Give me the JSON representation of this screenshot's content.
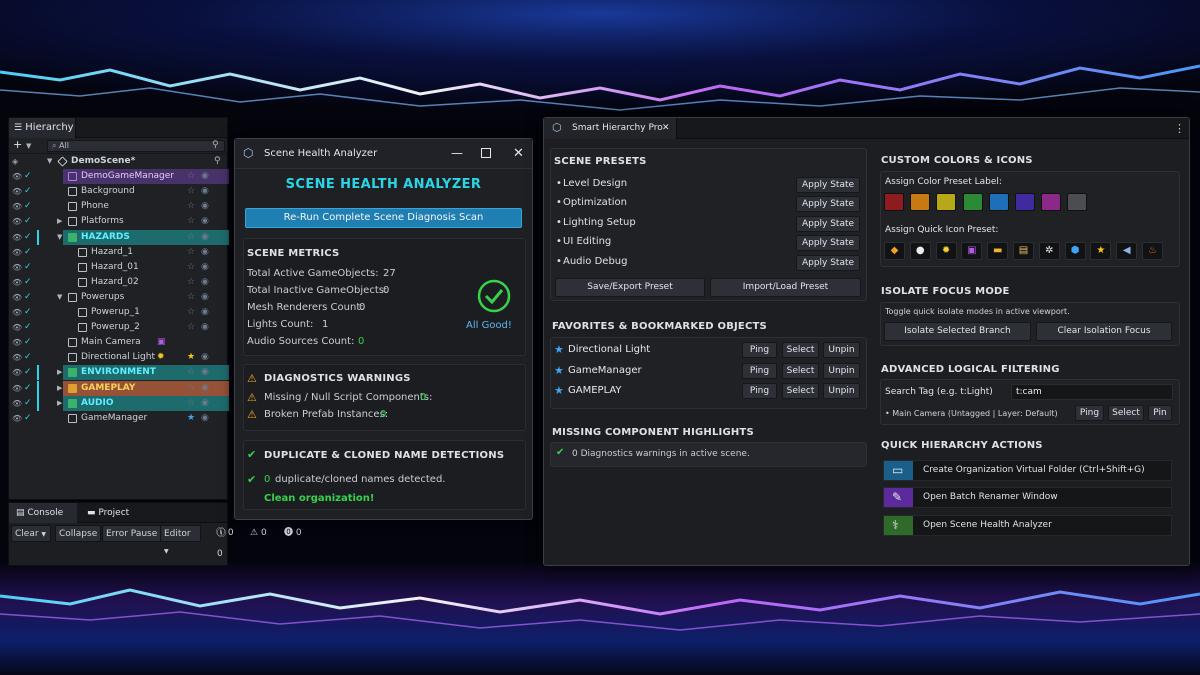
{
  "colors": {
    "accent_cyan": "#29d5e6",
    "success_green": "#35d24a",
    "warning_orange": "#f5a623",
    "star_blue": "#3fa4f5"
  },
  "hierarchy": {
    "tab_label": "Hierarchy",
    "toolbar_add": "+",
    "search_placeholder": "All",
    "rows": [
      {
        "label": "DemoScene*",
        "highlight": "none",
        "icon": "unity-logo-icon"
      },
      {
        "label": "DemoGameManager",
        "highlight": "purple",
        "icon": "cube-icon"
      },
      {
        "label": "Background",
        "highlight": "none",
        "icon": "cube-icon"
      },
      {
        "label": "Phone",
        "highlight": "none",
        "icon": "cube-icon"
      },
      {
        "label": "Platforms",
        "highlight": "none",
        "icon": "cube-icon"
      },
      {
        "label": "HAZARDS",
        "highlight": "teal",
        "icon": "folder-icon"
      },
      {
        "label": "Hazard_1",
        "highlight": "none",
        "icon": "cube-icon"
      },
      {
        "label": "Hazard_01",
        "highlight": "none",
        "icon": "cube-icon"
      },
      {
        "label": "Hazard_02",
        "highlight": "none",
        "icon": "cube-icon"
      },
      {
        "label": "Powerups",
        "highlight": "none",
        "icon": "cube-icon"
      },
      {
        "label": "Powerup_1",
        "highlight": "none",
        "icon": "cube-icon"
      },
      {
        "label": "Powerup_2",
        "highlight": "none",
        "icon": "cube-icon"
      },
      {
        "label": "Main Camera",
        "highlight": "none",
        "icon": "camera-icon"
      },
      {
        "label": "Directional Light",
        "highlight": "none",
        "icon": "cube-icon"
      },
      {
        "label": "ENVIRONMENT",
        "highlight": "teal",
        "icon": "folder-icon"
      },
      {
        "label": "GAMEPLAY",
        "highlight": "orange",
        "icon": "folder-icon"
      },
      {
        "label": "AUDIO",
        "highlight": "teal",
        "icon": "folder-icon"
      },
      {
        "label": "GameManager",
        "highlight": "none",
        "icon": "cube-icon"
      }
    ]
  },
  "console": {
    "tab_console": "Console",
    "tab_project": "Project",
    "clear": "Clear",
    "collapse": "Collapse",
    "error_pause": "Error Pause",
    "editor": "Editor",
    "info_count": "0",
    "warn_count": "0",
    "error_count": "0"
  },
  "health": {
    "window_title": "Scene Health Analyzer",
    "heading": "SCENE HEALTH ANALYZER",
    "rerun_button": "Re-Run Complete Scene Diagnosis Scan",
    "metrics_title": "SCENE METRICS",
    "metrics": [
      {
        "label": "Total Active GameObjects:",
        "value": "27"
      },
      {
        "label": "Total Inactive GameObjects:",
        "value": "0"
      },
      {
        "label": "Mesh Renderers Count:",
        "value": "0"
      },
      {
        "label": "Lights Count:",
        "value": "1"
      },
      {
        "label": "Audio Sources Count:",
        "value": "0"
      }
    ],
    "all_good": "All Good!",
    "warnings_title": "DIAGNOSTICS WARNINGS",
    "warnings": [
      {
        "label": "Missing / Null Script Components:",
        "value": "0"
      },
      {
        "label": "Broken Prefab Instances:",
        "value": "0"
      }
    ],
    "dup_title": "DUPLICATE & CLONED NAME DETECTIONS",
    "dup_count": "0",
    "dup_text": "duplicate/cloned names detected.",
    "clean": "Clean organization!"
  },
  "smart": {
    "tab_label": "Smart Hierarchy Pro",
    "presets_title": "SCENE PRESETS",
    "presets": [
      {
        "label": "Level Design",
        "button": "Apply State"
      },
      {
        "label": "Optimization",
        "button": "Apply State"
      },
      {
        "label": "Lighting Setup",
        "button": "Apply State"
      },
      {
        "label": "UI Editing",
        "button": "Apply State"
      },
      {
        "label": "Audio Debug",
        "button": "Apply State"
      }
    ],
    "save_preset": "Save/Export Preset",
    "load_preset": "Import/Load Preset",
    "favorites_title": "FAVORITES & BOOKMARKED OBJECTS",
    "favorites": [
      {
        "label": "Directional Light",
        "ping": "Ping",
        "select": "Select",
        "unpin": "Unpin"
      },
      {
        "label": "GameManager",
        "ping": "Ping",
        "select": "Select",
        "unpin": "Unpin"
      },
      {
        "label": "GAMEPLAY",
        "ping": "Ping",
        "select": "Select",
        "unpin": "Unpin"
      }
    ],
    "missing_title": "MISSING COMPONENT HIGHLIGHTS",
    "missing_text": "0 Diagnostics warnings in active scene.",
    "colors_title": "CUSTOM COLORS & ICONS",
    "color_label": "Assign Color Preset Label:",
    "swatches": [
      "#8e1b1d",
      "#c77a12",
      "#b6a819",
      "#2b8a36",
      "#1f6fb8",
      "#3f2aa0",
      "#8a2a86",
      "#4b4d52"
    ],
    "icon_label": "Assign Quick Icon Preset:",
    "icons": [
      {
        "name": "cube-icon",
        "glyph": "◆",
        "color": "#f0a02b"
      },
      {
        "name": "sphere-icon",
        "glyph": "●",
        "color": "#e8ecf0"
      },
      {
        "name": "lightbulb-icon",
        "glyph": "✹",
        "color": "#f5d23a"
      },
      {
        "name": "camera-icon",
        "glyph": "▣",
        "color": "#b05ae8"
      },
      {
        "name": "folder-icon",
        "glyph": "▬",
        "color": "#f0b430"
      },
      {
        "name": "script-icon",
        "glyph": "▤",
        "color": "#e3c06a"
      },
      {
        "name": "gear-icon",
        "glyph": "✲",
        "color": "#e8ecf0"
      },
      {
        "name": "prefab-icon",
        "glyph": "⬢",
        "color": "#3fa4f5"
      },
      {
        "name": "star-icon",
        "glyph": "★",
        "color": "#f5c61e"
      },
      {
        "name": "audio-icon",
        "glyph": "◀",
        "color": "#8fb4e8"
      },
      {
        "name": "fire-icon",
        "glyph": "♨",
        "color": "#f56a1e"
      }
    ],
    "isolate_title": "ISOLATE FOCUS MODE",
    "isolate_desc": "Toggle quick isolate modes in active viewport.",
    "isolate_branch": "Isolate Selected Branch",
    "clear_isolation": "Clear Isolation Focus",
    "filter_title": "ADVANCED LOGICAL FILTERING",
    "search_tag_label": "Search Tag (e.g. t:Light)",
    "search_tag_value": "t:cam",
    "result_text": "• Main Camera (Untagged | Layer: Default)",
    "result_ping": "Ping",
    "result_select": "Select",
    "result_pin": "Pin",
    "actions_title": "QUICK HIERARCHY ACTIONS",
    "actions": [
      {
        "label": "Create Organization Virtual Folder (Ctrl+Shift+G)",
        "icon": "folder-icon",
        "color": "#1a5f8a"
      },
      {
        "label": "Open Batch Renamer Window",
        "icon": "rename-icon",
        "color": "#5c2a9a"
      },
      {
        "label": "Open Scene Health Analyzer",
        "icon": "stethoscope-icon",
        "color": "#2f6a2a"
      }
    ]
  }
}
